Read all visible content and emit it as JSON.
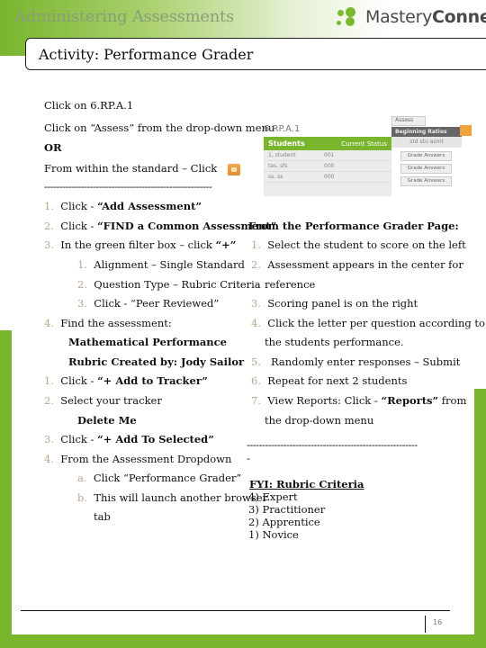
{
  "header": {
    "section_title": "Administering Assessments",
    "logo_text_light": "Mastery",
    "logo_text_bold": "Connect",
    "accent_color": "#79b52d"
  },
  "activity": {
    "title": "Activity:  Performance Grader"
  },
  "left": {
    "intro": [
      "Click on 6.RP.A.1",
      "Click on “Assess” from the drop-down menu",
      "OR",
      "From within the standard – Click"
    ],
    "divider": "-------------------------------------------------------",
    "steps_a": [
      {
        "num": "1.",
        "pre": "Click - ",
        "bold": "“Add Assessment”"
      },
      {
        "num": "2.",
        "pre": "Click - ",
        "bold": "“FIND a Common Assessment”"
      },
      {
        "num": "3.",
        "pre": "In the green filter box – click ",
        "bold": "“+”"
      }
    ],
    "substeps_a": [
      {
        "num": "1.",
        "text": "Alignment – Single Standard"
      },
      {
        "num": "2.",
        "text": "Question Type – Rubric Criteria"
      },
      {
        "num": "3.",
        "text": "Click - “Peer Reviewed”"
      }
    ],
    "step_4": {
      "num": "4.",
      "text": "Find the assessment:"
    },
    "assessment_name_1": "Mathematical Performance",
    "assessment_name_2": "Rubric Created by: Jody Sailor",
    "steps_b": [
      {
        "num": "1.",
        "pre": "Click - ",
        "bold": "“+ Add to Tracker”"
      },
      {
        "num": "2.",
        "pre": "Select your tracker",
        "bold": ""
      }
    ],
    "tracker_name": "Delete Me",
    "steps_c": [
      {
        "num": "3.",
        "pre": "Click - ",
        "bold": "“+ Add To Selected”"
      },
      {
        "num": "4.",
        "pre": "From the Assessment Dropdown",
        "bold": ""
      }
    ],
    "substeps_c": [
      {
        "num": "a.",
        "text": "Click “Performance Grader”"
      },
      {
        "num": "b.",
        "text": "This will launch another browser"
      }
    ],
    "substep_c_cont": "tab"
  },
  "screenshot": {
    "standard": "6.RP.A.1",
    "table_header_students": "Students",
    "table_header_status": "Current Status",
    "rows": [
      {
        "student": "1, student",
        "status": "001",
        "action": "Grade Answers"
      },
      {
        "student": "tas, sfs",
        "status": "000",
        "action": "Grade Answers"
      },
      {
        "student": "ss, ss",
        "status": "000",
        "action": "Grade Answers"
      }
    ],
    "assess_tab": "Assess",
    "menu_label": "Beginning Ratios",
    "menu_sub": "std  stu  asmt"
  },
  "right": {
    "heading": "From the Performance Grader Page:",
    "steps": [
      {
        "num": "1.",
        "text": "Select the student to score on the left"
      },
      {
        "num": "2.",
        "text": "Assessment appears in the center for"
      },
      {
        "num": "",
        "text": "reference"
      },
      {
        "num": "3.",
        "text": "Scoring panel is on the right"
      },
      {
        "num": "4.",
        "text": "Click the letter per question according to"
      },
      {
        "num": "",
        "text": "the students performance."
      },
      {
        "num": "5.",
        "text": " Randomly enter responses – Submit"
      },
      {
        "num": "6.",
        "text": "Repeat for next 2 students"
      }
    ],
    "step_7_pre": "View Reports:  Click - ",
    "step_7_bold": "“Reports”",
    "step_7_post": " from",
    "step_7_num": "7.",
    "step_7_cont": "the drop-down menu",
    "divider": "--------------------------------------------------------",
    "divider_tail": "-",
    "fyi_title": "FYI:  Rubric Criteria",
    "criteria": [
      "4) Expert",
      "3) Practitioner",
      "2) Apprentice",
      "1) Novice"
    ]
  },
  "footer": {
    "page_number": "16"
  }
}
